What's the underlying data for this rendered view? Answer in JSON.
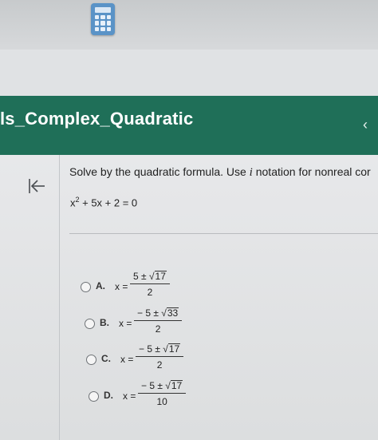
{
  "header": {
    "title": "ls_Complex_Quadratic"
  },
  "question": {
    "prompt_before": "Solve by the quadratic formula. Use ",
    "prompt_var": "i",
    "prompt_after": " notation for nonreal cor",
    "equation": {
      "base": "x",
      "exponent": "2",
      "rest": " + 5x + 2 = 0"
    }
  },
  "options": [
    {
      "letter": "A.",
      "lhs": "x =",
      "num_prefix": "5 ± ",
      "radicand": "17",
      "den": "2"
    },
    {
      "letter": "B.",
      "lhs": "x =",
      "num_prefix": "− 5 ± ",
      "radicand": "33",
      "den": "2"
    },
    {
      "letter": "C.",
      "lhs": "x =",
      "num_prefix": "− 5 ± ",
      "radicand": "17",
      "den": "2"
    },
    {
      "letter": "D.",
      "lhs": "x =",
      "num_prefix": "− 5 ± ",
      "radicand": "17",
      "den": "10"
    }
  ]
}
